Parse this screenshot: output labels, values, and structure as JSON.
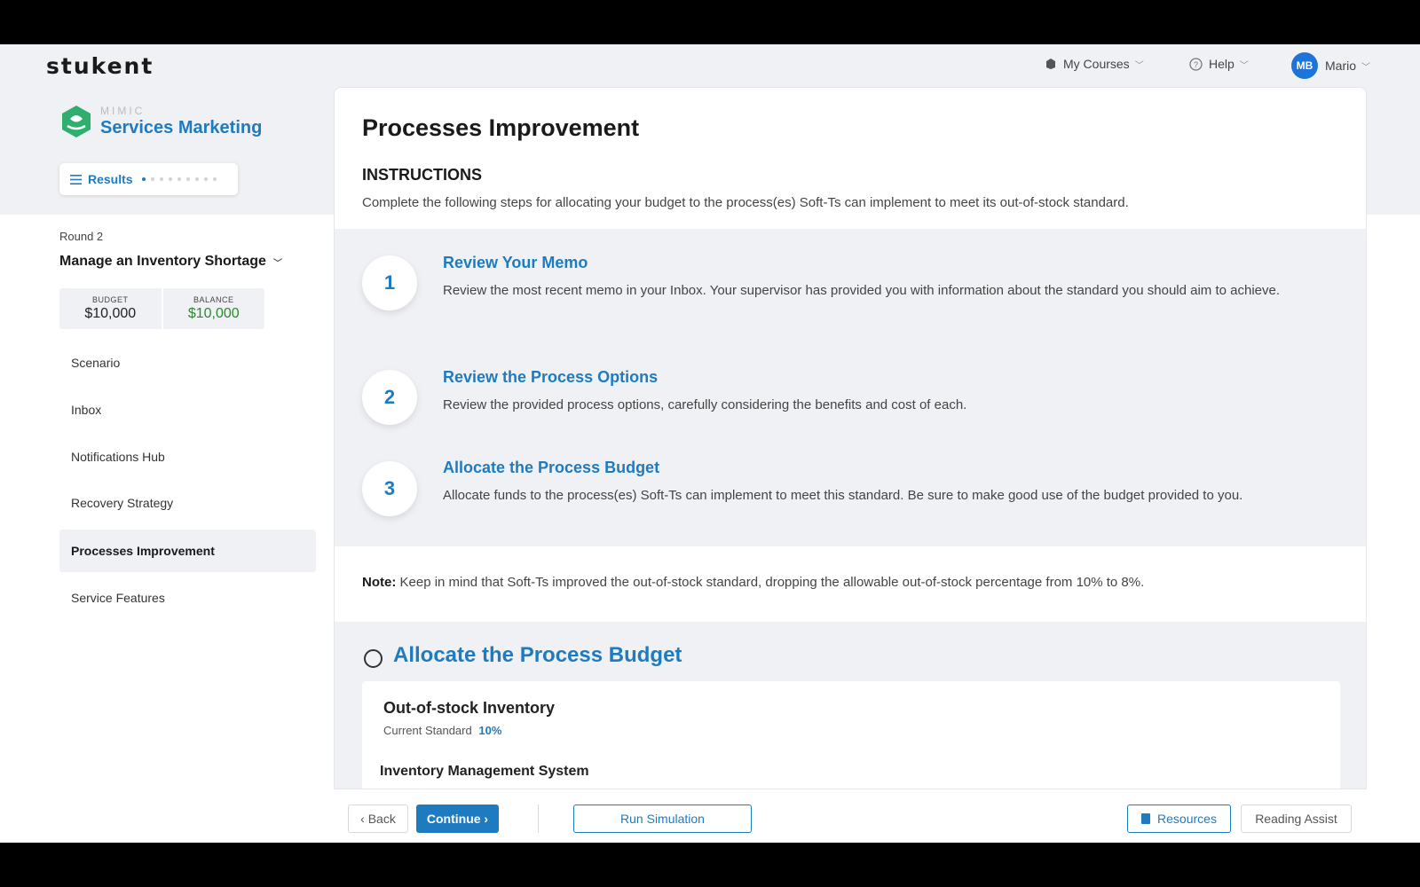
{
  "header": {
    "logo": "stukent",
    "my_courses": "My Courses",
    "help": "Help",
    "user_initials": "MB",
    "user_name": "Mario"
  },
  "sidebar": {
    "brand_small": "MIMIC",
    "brand_big": "Services Marketing",
    "results_label": "Results",
    "round_label": "Round 2",
    "round_title": "Manage an Inventory Shortage",
    "budget_label": "BUDGET",
    "budget_value": "$10,000",
    "balance_label": "BALANCE",
    "balance_value": "$10,000",
    "items": [
      {
        "label": "Scenario"
      },
      {
        "label": "Inbox"
      },
      {
        "label": "Notifications Hub"
      },
      {
        "label": "Recovery Strategy"
      },
      {
        "label": "Processes Improvement"
      },
      {
        "label": "Service Features"
      }
    ]
  },
  "main": {
    "title": "Processes Improvement",
    "instructions_heading": "INSTRUCTIONS",
    "instructions_text": "Complete the following steps for allocating your budget to the process(es) Soft-Ts can implement to meet its out-of-stock standard.",
    "steps": [
      {
        "num": "1",
        "title": "Review Your Memo",
        "text": "Review the most recent memo in your Inbox. Your supervisor has provided you with information about the standard you should aim to achieve."
      },
      {
        "num": "2",
        "title": "Review the Process Options",
        "text": "Review the provided process options, carefully considering the benefits and cost of each."
      },
      {
        "num": "3",
        "title": "Allocate the Process Budget",
        "text": "Allocate funds to the process(es) Soft-Ts can implement to meet this standard. Be sure to make good use of the budget provided to you."
      }
    ],
    "note_label": "Note:",
    "note_text": "Keep in mind that Soft-Ts improved the out-of-stock standard, dropping the allowable out-of-stock percentage from 10% to 8%.",
    "allocate_title": "Allocate the Process Budget",
    "oos_title": "Out-of-stock Inventory",
    "oos_std_label": "Current Standard",
    "oos_std_value": "10%",
    "ims_title": "Inventory Management System"
  },
  "footer": {
    "back": "‹ Back",
    "continue": "Continue ›",
    "run_simulation": "Run Simulation",
    "resources": "Resources",
    "reading_assist": "Reading Assist"
  },
  "colors": {
    "accent": "#1f7bc0",
    "balance_green": "#2c8a2c",
    "panel_gray": "#eff1f4"
  }
}
